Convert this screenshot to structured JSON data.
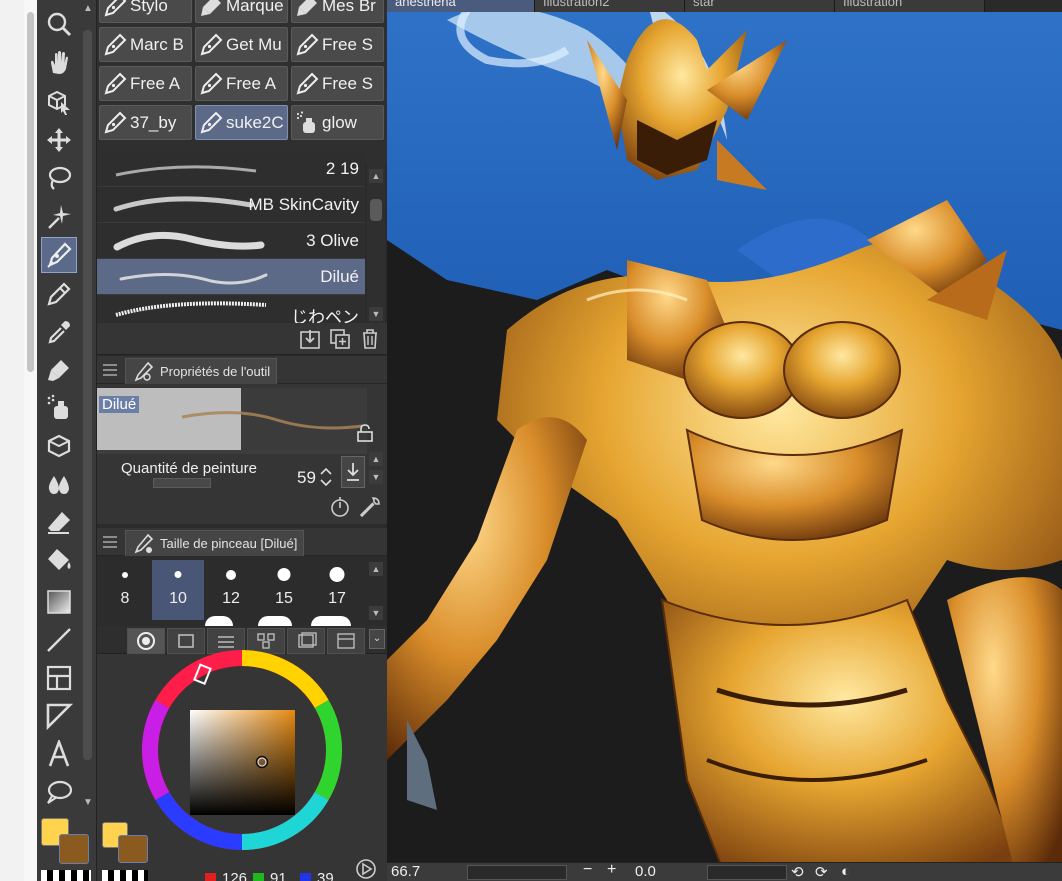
{
  "toolbar": {
    "tools": [
      {
        "name": "zoom-tool",
        "icon": "magnifier-icon"
      },
      {
        "name": "hand-tool",
        "icon": "hand-icon"
      },
      {
        "name": "object-tool",
        "icon": "cube-cursor-icon"
      },
      {
        "name": "move-tool",
        "icon": "move-arrows-icon"
      },
      {
        "name": "lasso-tool",
        "icon": "lasso-icon"
      },
      {
        "name": "magic-wand-tool",
        "icon": "sparkle-icon"
      },
      {
        "name": "pen-tool",
        "icon": "pen-nib-icon",
        "active": true
      },
      {
        "name": "pencil-tool",
        "icon": "pencil-icon"
      },
      {
        "name": "eyedropper-tool",
        "icon": "eyedropper-icon"
      },
      {
        "name": "brush-tool",
        "icon": "brush-icon"
      },
      {
        "name": "airbrush-tool",
        "icon": "airbrush-icon"
      },
      {
        "name": "decoration-tool",
        "icon": "box-icon"
      },
      {
        "name": "blend-tool",
        "icon": "drops-icon"
      },
      {
        "name": "eraser-tool",
        "icon": "eraser-icon"
      },
      {
        "name": "fill-tool",
        "icon": "bucket-icon"
      },
      {
        "name": "gradient-tool",
        "icon": "gradient-icon"
      },
      {
        "name": "line-tool",
        "icon": "line-icon"
      },
      {
        "name": "frame-tool",
        "icon": "frame-icon"
      },
      {
        "name": "ruler-tool",
        "icon": "ruler-icon"
      },
      {
        "name": "text-tool",
        "icon": "text-a-icon"
      },
      {
        "name": "balloon-tool",
        "icon": "speech-balloon-icon"
      }
    ],
    "main_color": "#FFD34E",
    "sub_color": "#8A5A1E"
  },
  "subtools": [
    {
      "label": "Stylo"
    },
    {
      "label": "Marque"
    },
    {
      "label": "Mes Br"
    },
    {
      "label": "Marc B"
    },
    {
      "label": "Get Mu"
    },
    {
      "label": "Free S"
    },
    {
      "label": "Free A"
    },
    {
      "label": "Free A"
    },
    {
      "label": "Free S"
    },
    {
      "label": "37_by"
    },
    {
      "label": "suke2C",
      "selected": true
    },
    {
      "label": "glow"
    }
  ],
  "brushes": [
    {
      "name": "2 19"
    },
    {
      "name": "MB SkinCavity"
    },
    {
      "name": "3 Olive"
    },
    {
      "name": "Dilué",
      "selected": true
    },
    {
      "name": "じわペン"
    }
  ],
  "tool_properties": {
    "tab_label": "Propriétés de l'outil",
    "preview_name": "Dilué",
    "paint_amount_label": "Quantité de peinture",
    "paint_amount_value": "59"
  },
  "brush_size": {
    "tab_label": "Taille de pinceau [Dilué]",
    "sizes": [
      "8",
      "10",
      "12",
      "15",
      "17"
    ],
    "selected": "10"
  },
  "color": {
    "r": "126",
    "g": "91",
    "b": "39",
    "accent": "#5c6a88"
  },
  "canvas": {
    "tabs": [
      "anesthena",
      "Illustration2",
      "star",
      "Illustration"
    ],
    "active_tab": "anesthena",
    "zoom": "66.7",
    "rotation": "0.0"
  }
}
